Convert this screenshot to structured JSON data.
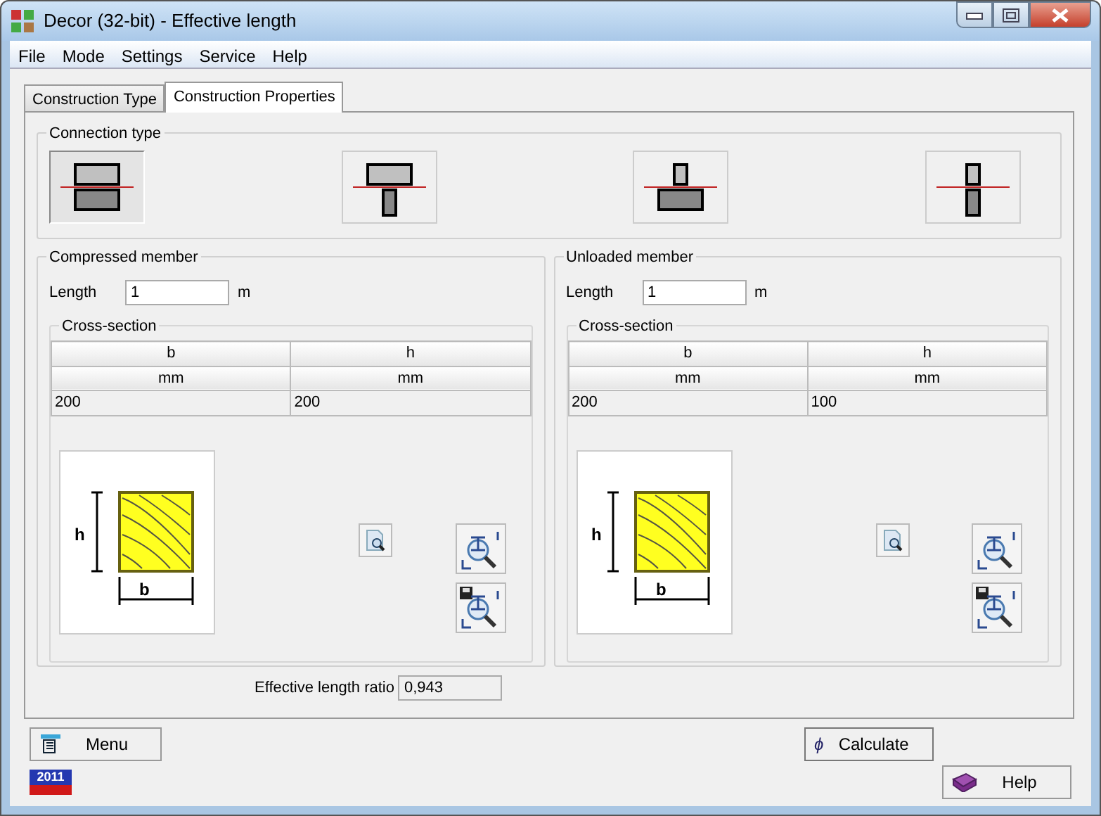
{
  "window": {
    "title": "Decor (32-bit) - Effective length"
  },
  "menu": [
    "File",
    "Mode",
    "Settings",
    "Service",
    "Help"
  ],
  "tabs": [
    {
      "label": "Construction Type",
      "selected": false
    },
    {
      "label": "Construction Properties",
      "selected": true
    }
  ],
  "connection_type": {
    "title": "Connection type",
    "options": [
      {
        "kind": "wide-wide",
        "selected": true
      },
      {
        "kind": "wide-narrow",
        "selected": false
      },
      {
        "kind": "narrow-wide",
        "selected": false
      },
      {
        "kind": "narrow-narrow",
        "selected": false
      }
    ]
  },
  "members": [
    {
      "title": "Compressed member",
      "length_label": "Length",
      "length": "1",
      "unit": "m",
      "cross_section": {
        "title": "Cross-section",
        "columns": [
          {
            "name": "b",
            "unit": "mm",
            "value": "200"
          },
          {
            "name": "h",
            "unit": "mm",
            "value": "200"
          }
        ]
      },
      "dim_h": "h",
      "dim_b": "b"
    },
    {
      "title": "Unloaded member",
      "length_label": "Length",
      "length": "1",
      "unit": "m",
      "cross_section": {
        "title": "Cross-section",
        "columns": [
          {
            "name": "b",
            "unit": "mm",
            "value": "200"
          },
          {
            "name": "h",
            "unit": "mm",
            "value": "100"
          }
        ]
      },
      "dim_h": "h",
      "dim_b": "b"
    }
  ],
  "ratio": {
    "label": "Effective length ratio",
    "value": "0,943"
  },
  "buttons": {
    "menu": "Menu",
    "calculate_icon": "ϕ",
    "calculate": "Calculate",
    "help": "Help"
  },
  "year_badge": "2011"
}
